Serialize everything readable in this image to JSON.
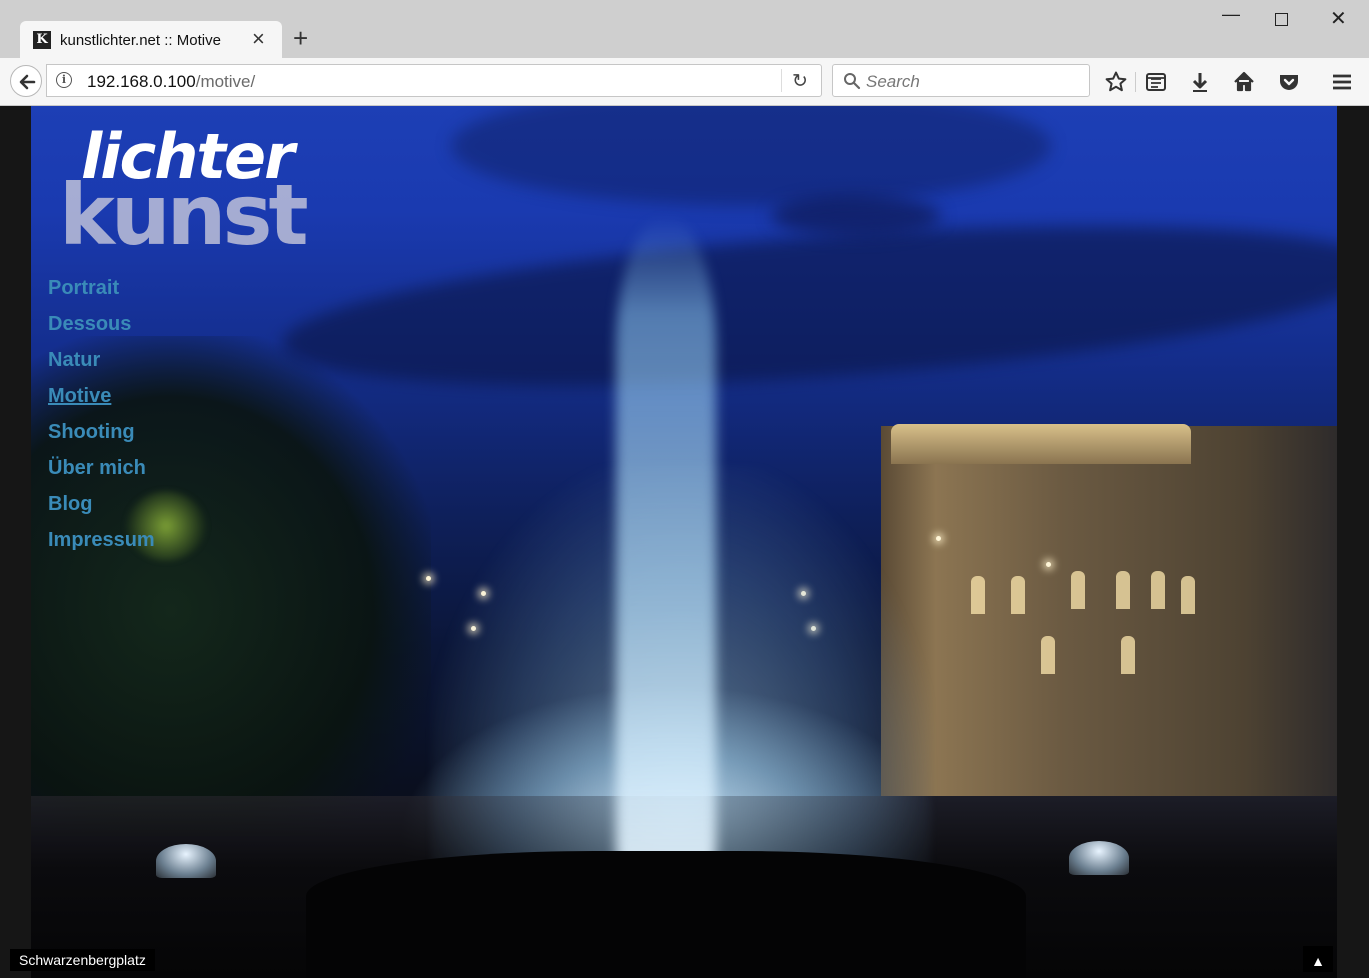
{
  "browser": {
    "tab_title": "kunstlichter.net :: Motive",
    "tab_favicon_letter": "K",
    "url_host": "192.168.0.100",
    "url_path": "/motive/",
    "search_placeholder": "Search",
    "icons": [
      "back-arrow-icon",
      "info-icon",
      "reload-icon",
      "search-icon",
      "bookmark-star-icon",
      "reader-list-icon",
      "download-icon",
      "home-icon",
      "pocket-icon",
      "hamburger-menu-icon",
      "minimize-icon",
      "maximize-icon",
      "close-icon",
      "new-tab-plus-icon"
    ]
  },
  "site": {
    "logo_top": "lichter",
    "logo_bottom": "kunst",
    "nav": [
      {
        "label": "Portrait",
        "active": false
      },
      {
        "label": "Dessous",
        "active": false
      },
      {
        "label": "Natur",
        "active": false
      },
      {
        "label": "Motive",
        "active": true
      },
      {
        "label": "Shooting",
        "active": false
      },
      {
        "label": "Über mich",
        "active": false
      },
      {
        "label": "Blog",
        "active": false
      },
      {
        "label": "Impressum",
        "active": false
      }
    ],
    "caption": "Schwarzenbergplatz",
    "to_top_symbol": "▲",
    "colors": {
      "nav_link": "#3a8bb8",
      "sky": "#1d3fb5"
    }
  }
}
